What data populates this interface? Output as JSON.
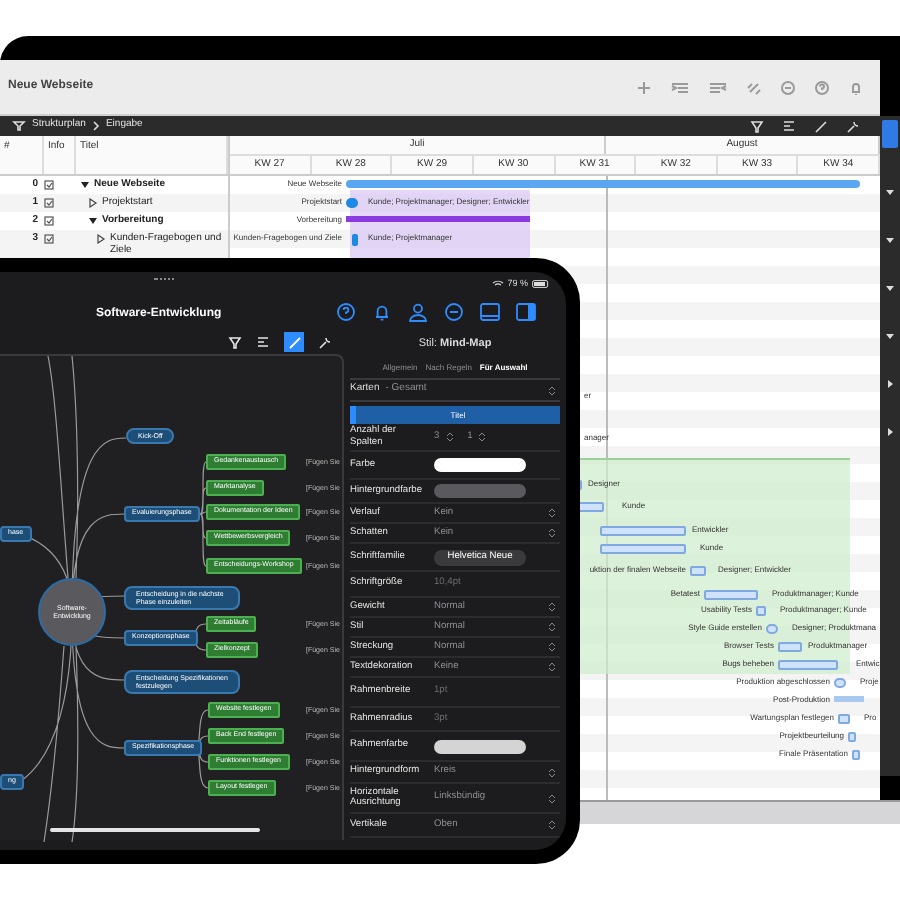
{
  "laptop": {
    "title": "Neue Webseite",
    "breadcrumb": [
      "Strukturplan",
      "Eingabe"
    ],
    "table": {
      "columns": [
        "#",
        "Info",
        "Titel"
      ],
      "months": [
        "Juli",
        "August"
      ],
      "weeks": [
        "KW 27",
        "KW 28",
        "KW 29",
        "KW 30",
        "KW 31",
        "KW 32",
        "KW 33",
        "KW 34"
      ],
      "rows": [
        {
          "number": "0",
          "title": "Neue Webseite",
          "kind": "summary",
          "expanded": true,
          "bar_label": "Neue Webseite"
        },
        {
          "number": "1",
          "title": "Projektstart",
          "kind": "task",
          "expanded": false,
          "bar_label": "Projektstart",
          "resources": "Kunde; Projektmanager; Designer; Entwickler"
        },
        {
          "number": "2",
          "title": "Vorbereitung",
          "kind": "summary",
          "expanded": true,
          "bar_label": "Vorbereitung"
        },
        {
          "number": "3",
          "title": "Kunden-Fragebogen und Ziele",
          "kind": "task",
          "expanded": false,
          "bar_label": "Kunden-Fragebogen und Ziele",
          "resources": "Kunde; Projektmanager"
        }
      ]
    },
    "more_tasks": [
      {
        "resources": "er"
      },
      {
        "resources": "anager"
      },
      {
        "resources": "Designer"
      },
      {
        "resources": "Kunde"
      },
      {
        "resources": "Entwickler"
      },
      {
        "resources": "Kunde"
      },
      {
        "label": "uktion der finalen Webseite",
        "resources": "Designer; Entwickler"
      },
      {
        "label": "Betatest",
        "resources": "Produktmanager; Kunde"
      },
      {
        "label": "Usability Tests",
        "resources": "Produktmanager; Kunde"
      },
      {
        "label": "Style Guide erstellen",
        "resources": "Designer; Produktmana"
      },
      {
        "label": "Browser Tests",
        "resources": "Produktmanager"
      },
      {
        "label": "Bugs beheben",
        "resources": "Entwic"
      },
      {
        "label": "Produktion abgeschlossen",
        "resources": "Proje"
      },
      {
        "label": "Post-Produktion"
      },
      {
        "label": "Wartungsplan festlegen",
        "resources": "Pro"
      },
      {
        "label": "Projektbeurteilung"
      },
      {
        "label": "Finale Präsentation"
      }
    ]
  },
  "tablet": {
    "battery": "79 %",
    "title": "Software-Entwicklung",
    "mind_map": {
      "nodes": [
        {
          "kind": "root",
          "text": "Software-Entwicklung"
        },
        {
          "kind": "decision",
          "text": "Kick-Off"
        },
        {
          "kind": "topic",
          "text": "Evaluierungsphase"
        },
        {
          "kind": "topic",
          "text": "hase"
        },
        {
          "kind": "task",
          "text": "Gedankenaustausch",
          "note": "[Fügen Sie"
        },
        {
          "kind": "task",
          "text": "Marktanalyse",
          "note": "[Fügen Sie"
        },
        {
          "kind": "task",
          "text": "Dokumentation der Ideen",
          "note": "[Fügen Sie"
        },
        {
          "kind": "task",
          "text": "Wettbewerbsvergleich",
          "note": "[Fügen Sie"
        },
        {
          "kind": "task",
          "text": "Entscheidungs-Workshop",
          "note": "[Fügen Sie"
        },
        {
          "kind": "decision",
          "text": "Entscheidung in die nächste Phase einzuleiten"
        },
        {
          "kind": "topic",
          "text": "Konzeptionsphase"
        },
        {
          "kind": "task",
          "text": "Zeitabläufe",
          "note": "[Fügen Sie"
        },
        {
          "kind": "task",
          "text": "Zielkonzept",
          "note": "[Fügen Sie"
        },
        {
          "kind": "decision",
          "text": "Entscheidung Spezifikationen festzulegen"
        },
        {
          "kind": "topic",
          "text": "Spezifikationsphase"
        },
        {
          "kind": "task",
          "text": "Website festlegen",
          "note": "[Fügen Sie"
        },
        {
          "kind": "task",
          "text": "Back End festlegen",
          "note": "[Fügen Sie"
        },
        {
          "kind": "task",
          "text": "Funktionen festlegen",
          "note": "[Fügen Sie"
        },
        {
          "kind": "task",
          "text": "Layout festlegen",
          "note": "[Fügen Sie"
        },
        {
          "kind": "topic",
          "text": "ng"
        }
      ]
    },
    "inspector": {
      "title": "Stil: **Mind-Map**",
      "tabs": [
        {
          "label": "Allgemein",
          "selected": false
        },
        {
          "label": "Nach Regeln",
          "selected": false
        },
        {
          "label": "Für Auswahl",
          "selected": true
        }
      ],
      "scope": {
        "label": "Karten",
        "value": "- Gesamt"
      },
      "preview": {
        "column": "Titel"
      },
      "rows": [
        {
          "kind": "stepper2",
          "label": "Anzahl der Spalten",
          "value": "3",
          "value_2": "1"
        },
        {
          "kind": "swatch",
          "label": "Farbe",
          "color": "#ffffff"
        },
        {
          "kind": "swatch",
          "label": "Hintergrundfarbe",
          "color": "#5a5a5e"
        },
        {
          "kind": "select",
          "label": "Verlauf",
          "value": "Kein"
        },
        {
          "kind": "select",
          "label": "Schatten",
          "value": "Kein"
        },
        {
          "kind": "pill",
          "label": "Schriftfamilie",
          "value": "Helvetica Neue"
        },
        {
          "kind": "text",
          "label": "Schriftgröße",
          "value": "10,4pt"
        },
        {
          "kind": "select",
          "label": "Gewicht",
          "value": "Normal"
        },
        {
          "kind": "select",
          "label": "Stil",
          "value": "Normal"
        },
        {
          "kind": "select",
          "label": "Streckung",
          "value": "Normal"
        },
        {
          "kind": "select",
          "label": "Textdekoration",
          "value": "Keine"
        },
        {
          "kind": "text",
          "label": "Rahmenbreite",
          "value": "1pt"
        },
        {
          "kind": "text",
          "label": "Rahmenradius",
          "value": "3pt"
        },
        {
          "kind": "swatch",
          "label": "Rahmenfarbe",
          "color": "#d4d4d4"
        },
        {
          "kind": "select",
          "label": "Hintergrundform",
          "value": "Kreis"
        },
        {
          "kind": "select",
          "label": "Horizontale Ausrichtung",
          "value": "Linksbündig"
        },
        {
          "kind": "select",
          "label": "Vertikale",
          "value": "Oben"
        }
      ]
    }
  }
}
